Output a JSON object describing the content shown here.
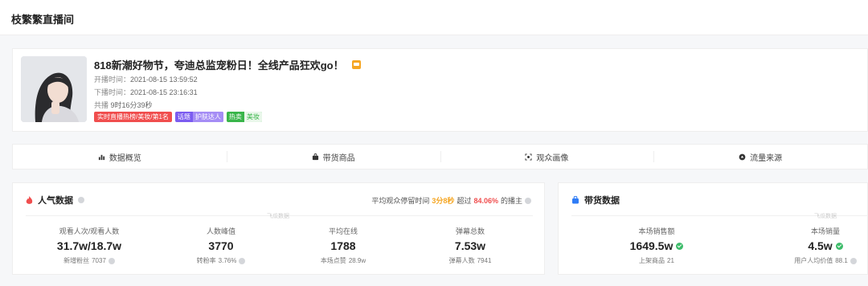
{
  "page": {
    "title": "枝繁繁直播间"
  },
  "live": {
    "title": "818新潮好物节，夸迪总监宠粉日！全线产品狂欢go！",
    "start_label": "开播时间：",
    "start_time": "2021-08-15 13:59:52",
    "end_label": "下播时间：",
    "end_time": "2021-08-15 23:16:31",
    "duration_label": "共播",
    "duration": "9时16分39秒",
    "tags": {
      "rank": "实时直播热榜/美妆/第1名",
      "topic": "话题",
      "topic_value": "护肤达人",
      "hot": "热卖",
      "hot_value": "美妆"
    }
  },
  "tabs": [
    {
      "label": "数据概览",
      "icon": "bar-chart-icon"
    },
    {
      "label": "带货商品",
      "icon": "bag-icon"
    },
    {
      "label": "观众画像",
      "icon": "portrait-icon"
    },
    {
      "label": "流量来源",
      "icon": "traffic-icon"
    }
  ],
  "popularity": {
    "title": "人气数据",
    "avg_prefix": "平均观众停留时间",
    "avg_time": "3分8秒",
    "avg_mid": "超过",
    "avg_pct": "84.06%",
    "avg_suffix": "的播主",
    "watermark": "飞瓜数据",
    "stats": [
      {
        "label": "观看人次/观看人数",
        "value": "31.7w/18.7w",
        "sub_label": "新增粉丝",
        "sub_value": "7037"
      },
      {
        "label": "人数峰值",
        "value": "3770",
        "sub_label": "转粉率",
        "sub_value": "3.76%"
      },
      {
        "label": "平均在线",
        "value": "1788",
        "sub_label": "本场点赞",
        "sub_value": "28.9w"
      },
      {
        "label": "弹幕总数",
        "value": "7.53w",
        "sub_label": "弹幕人数",
        "sub_value": "7941"
      }
    ]
  },
  "goods": {
    "title": "带货数据",
    "watermark": "飞瓜数据",
    "stats": [
      {
        "label": "本场销售额",
        "value": "1649.5w",
        "sub_label": "上架商品",
        "sub_value": "21"
      },
      {
        "label": "本场销量",
        "value": "4.5w",
        "sub_label": "用户人均价值",
        "sub_value": "88.1"
      }
    ]
  },
  "colors": {
    "accent_red": "#f04e4e",
    "accent_orange": "#f5a623",
    "verified_green": "#3dbc6a",
    "cart_blue": "#2f7cf6"
  }
}
